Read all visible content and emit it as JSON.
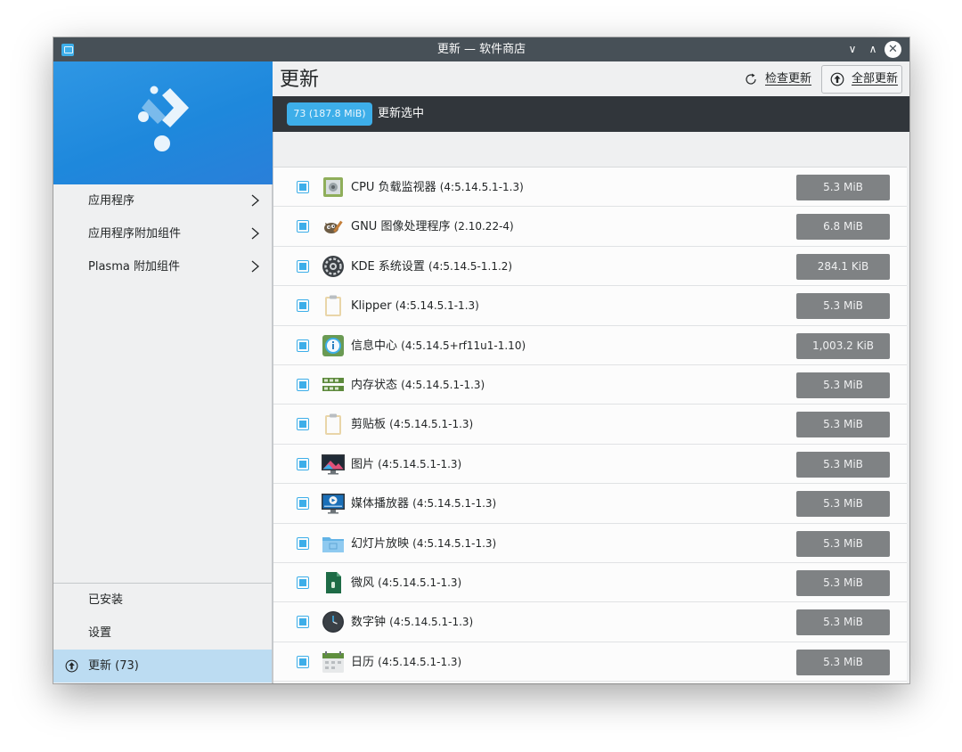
{
  "window": {
    "title": "更新 — 软件商店",
    "controls": {
      "minimize": "∨",
      "maximize": "∧",
      "close": "✕"
    }
  },
  "sidebar": {
    "items": [
      {
        "label": "应用程序"
      },
      {
        "label": "应用程序附加组件"
      },
      {
        "label": "Plasma 附加组件"
      }
    ],
    "bottom": [
      {
        "label": "已安装"
      },
      {
        "label": "设置"
      },
      {
        "label": "更新 (73)"
      }
    ]
  },
  "header": {
    "title": "更新",
    "check_label": "检查更新",
    "update_all_label": "全部更新"
  },
  "statusbar": {
    "count": "73 (187.8 MiB)",
    "text": "更新选中"
  },
  "colors": {
    "accent": "#3daee9",
    "dark": "#31363b",
    "size_badge": "#7f8284"
  },
  "updates": [
    {
      "name": "CPU 负载监视器",
      "version": "(4:5.14.5.1-1.3)",
      "size": "5.3 MiB",
      "icon": "cpu-monitor-icon"
    },
    {
      "name": "GNU 图像处理程序",
      "version": "(2.10.22-4)",
      "size": "6.8 MiB",
      "icon": "gimp-icon"
    },
    {
      "name": "KDE 系统设置",
      "version": "(4:5.14.5-1.1.2)",
      "size": "284.1 KiB",
      "icon": "system-settings-icon"
    },
    {
      "name": "Klipper",
      "version": "(4:5.14.5.1-1.3)",
      "size": "5.3 MiB",
      "icon": "clipboard-icon"
    },
    {
      "name": "信息中心",
      "version": "(4:5.14.5+rf11u1-1.10)",
      "size": "1,003.2 KiB",
      "icon": "info-center-icon"
    },
    {
      "name": "内存状态",
      "version": "(4:5.14.5.1-1.3)",
      "size": "5.3 MiB",
      "icon": "memory-icon"
    },
    {
      "name": "剪贴板",
      "version": "(4:5.14.5.1-1.3)",
      "size": "5.3 MiB",
      "icon": "clipboard-icon"
    },
    {
      "name": "图片",
      "version": "(4:5.14.5.1-1.3)",
      "size": "5.3 MiB",
      "icon": "picture-icon"
    },
    {
      "name": "媒体播放器",
      "version": "(4:5.14.5.1-1.3)",
      "size": "5.3 MiB",
      "icon": "media-player-icon"
    },
    {
      "name": "幻灯片放映",
      "version": "(4:5.14.5.1-1.3)",
      "size": "5.3 MiB",
      "icon": "slideshow-folder-icon"
    },
    {
      "name": "微风",
      "version": "(4:5.14.5.1-1.3)",
      "size": "5.3 MiB",
      "icon": "breeze-icon"
    },
    {
      "name": "数字钟",
      "version": "(4:5.14.5.1-1.3)",
      "size": "5.3 MiB",
      "icon": "clock-icon"
    },
    {
      "name": "日历",
      "version": "(4:5.14.5.1-1.3)",
      "size": "5.3 MiB",
      "icon": "calendar-icon"
    }
  ]
}
